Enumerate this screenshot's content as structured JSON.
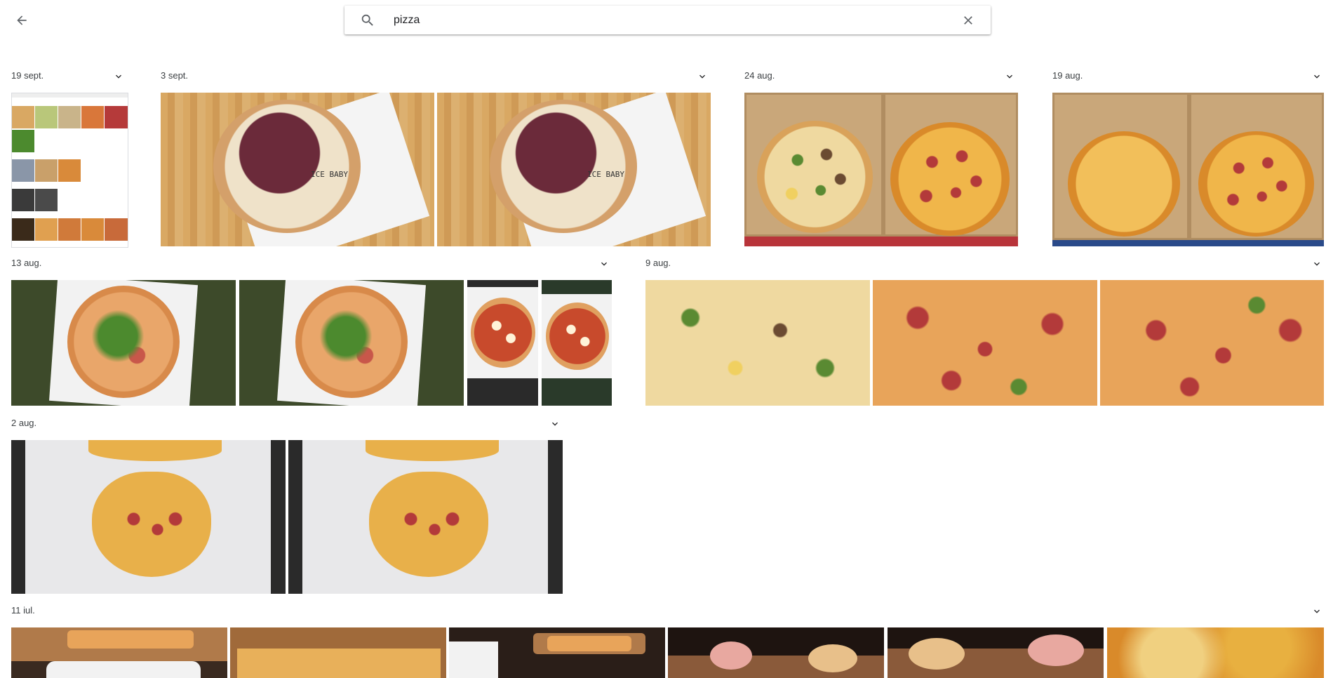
{
  "search": {
    "query": "pizza",
    "back_icon": "arrow-left-icon",
    "search_icon": "search-icon",
    "clear_icon": "close-icon"
  },
  "groups": [
    {
      "date": "19 sept.",
      "photo_count": 1
    },
    {
      "date": "3 sept.",
      "photo_count": 2
    },
    {
      "date": "24 aug.",
      "photo_count": 1
    },
    {
      "date": "19 aug.",
      "photo_count": 1
    },
    {
      "date": "13 aug.",
      "photo_count": 4
    },
    {
      "date": "9 aug.",
      "photo_count": 3
    },
    {
      "date": "2 aug.",
      "photo_count": 2
    },
    {
      "date": "11 iul.",
      "photo_count": 6
    }
  ],
  "photo_texts": {
    "ice_baby": "ICE BABY"
  },
  "colors": {
    "background": "#ffffff",
    "text": "#3c4043",
    "icon": "#5f6368"
  }
}
